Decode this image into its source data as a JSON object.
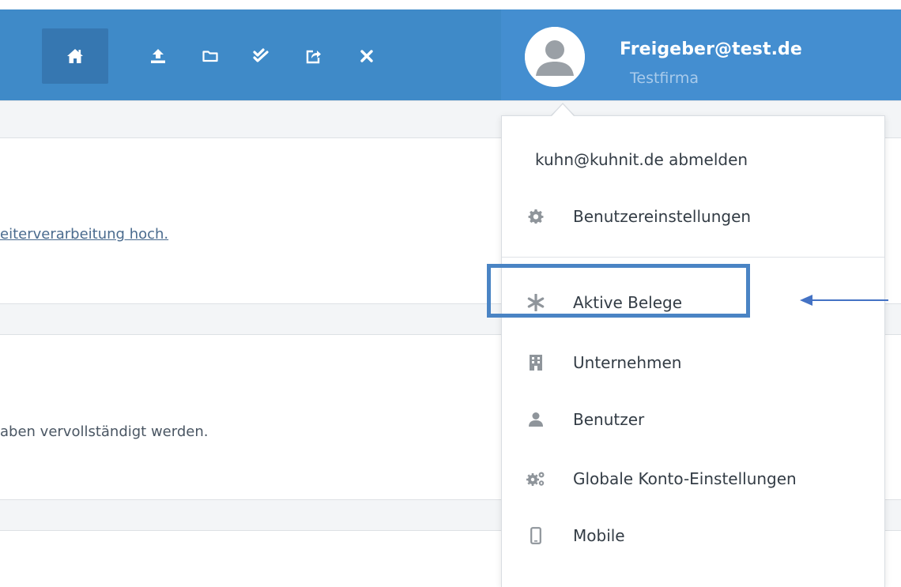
{
  "header": {
    "nav": [
      {
        "name": "home-icon"
      },
      {
        "name": "upload-icon"
      },
      {
        "name": "folder-icon"
      },
      {
        "name": "double-check-icon"
      },
      {
        "name": "share-icon"
      },
      {
        "name": "close-icon"
      }
    ],
    "user": {
      "name": "Freigeber@test.de",
      "company": "Testfirma",
      "avatar_icon": "user-avatar-icon"
    }
  },
  "background": {
    "text1": "eiterverarbeitung hoch.",
    "text2": "aben vervollständigt werden."
  },
  "menu": {
    "logout": "kuhn@kuhnit.de abmelden",
    "items": [
      {
        "label": "Benutzereinstellungen",
        "icon": "gear-icon"
      },
      {
        "label": "Aktive Belege",
        "icon": "asterisk-icon"
      },
      {
        "label": "Unternehmen",
        "icon": "building-icon"
      },
      {
        "label": "Benutzer",
        "icon": "user-icon"
      },
      {
        "label": "Globale Konto-Einstellungen",
        "icon": "gears-icon"
      },
      {
        "label": "Mobile",
        "icon": "mobile-icon"
      }
    ]
  },
  "colors": {
    "header": "#3f8ac8",
    "highlight": "#4a84c4",
    "arrow": "#4472c4"
  }
}
